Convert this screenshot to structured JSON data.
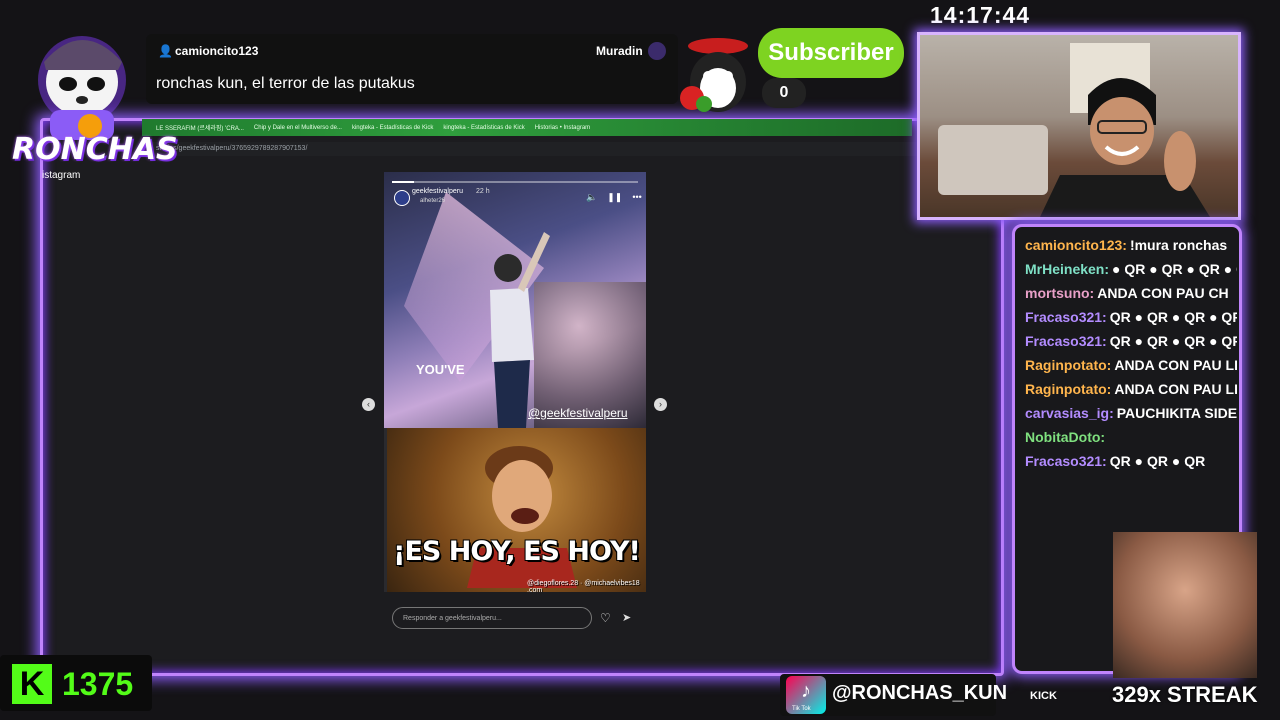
{
  "clock": "14:17:44",
  "message": {
    "user": "camioncito123",
    "text": "ronchas kun, el terror de las putakus",
    "right_label": "Muradin"
  },
  "logo": {
    "text": "RONCHAS",
    "sub": "istagram"
  },
  "subscriber": {
    "label": "Subscriber",
    "count": "0"
  },
  "browser": {
    "tabs": [
      "LE SSERAFIM (르세라핌) 'CRA...",
      "Chip y Dale en el Multiverso de...",
      "kingteka - Estadísticas de Kick",
      "kingteka - Estadísticas de Kick",
      "Historias • Instagram"
    ],
    "url": "stories/geekfestivalperu/3765929789287907153/"
  },
  "story": {
    "user": "geekfestivalperu",
    "time": "22 h",
    "sub": "alheter26",
    "overlay_word": "YOU'VE",
    "mention": "@geekfestivalperu",
    "meme_text": "¡ES HOY, ES HOY!",
    "meme_credit": "@diegoflores.28 · @michaelvibes18 .com",
    "reply_placeholder": "Responder a geekfestivalperu..."
  },
  "chat": [
    {
      "name": "camioncito123:",
      "color": "#ffb54d",
      "text": "!mura ronchas"
    },
    {
      "name": "MrHeineken:",
      "color": "#7fe0c6",
      "text": "● QR ● QR ● QR ● QR ● QR ● QR ● QR"
    },
    {
      "name": "mortsuno:",
      "color": "#e8a0c8",
      "text": "ANDA CON PAU CH"
    },
    {
      "name": "Fracaso321:",
      "color": "#b38cff",
      "text": "QR ● QR ● QR ● QR ● QR ● QR ●"
    },
    {
      "name": "Fracaso321:",
      "color": "#b38cff",
      "text": "QR ● QR ● QR ● QR ● QR ● QR ●"
    },
    {
      "name": "Raginpotato:",
      "color": "#ffb54d",
      "text": "ANDA CON PAU LE METES UN TAMPON Y GO"
    },
    {
      "name": "Raginpotato:",
      "color": "#ffb54d",
      "text": "ANDA CON PAU LE METES UN TAMPON Y GO"
    },
    {
      "name": "carvasias_ig:",
      "color": "#b38cff",
      "text": "PAUCHIKITA SIDERAL ..."
    },
    {
      "name": "NobitaDoto:",
      "color": "#7fe07f",
      "text": ""
    },
    {
      "name": "Fracaso321:",
      "color": "#b38cff",
      "text": "QR ● QR ● QR"
    }
  ],
  "kick": {
    "logo": "K",
    "count": "1375"
  },
  "tiktok": {
    "handle": "@RONCHAS_KUN",
    "label": "Tik Tok"
  },
  "footer": {
    "socials": "KICK",
    "streak": "329x STREAK"
  }
}
